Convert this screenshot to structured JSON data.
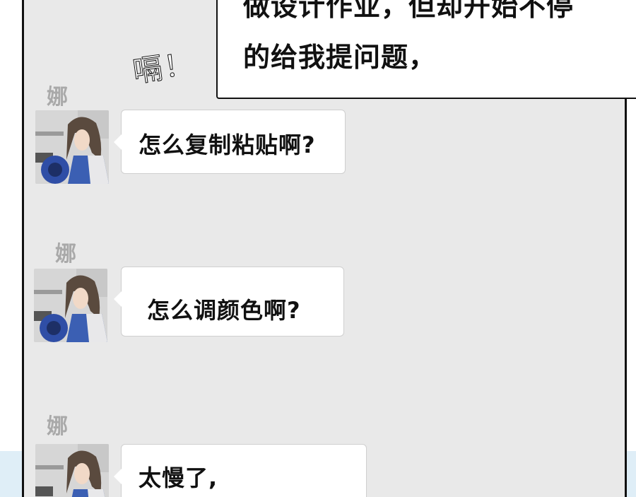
{
  "caption": {
    "line1": "做设计作业，但却开始不停",
    "line2": "的给我提问题，"
  },
  "sound_effect": "嗝！",
  "messages": [
    {
      "sender": "娜",
      "text": "怎么复制粘贴啊?"
    },
    {
      "sender": "娜",
      "text": "怎么调颜色啊?"
    },
    {
      "sender": "娜",
      "text": "太慢了,"
    }
  ],
  "colors": {
    "panel_background": "#e9e9e9",
    "panel_border": "#111111",
    "bubble_background": "#ffffff",
    "sender_name": "#a9a9a9",
    "bottom_tint": "#dfeef7"
  }
}
